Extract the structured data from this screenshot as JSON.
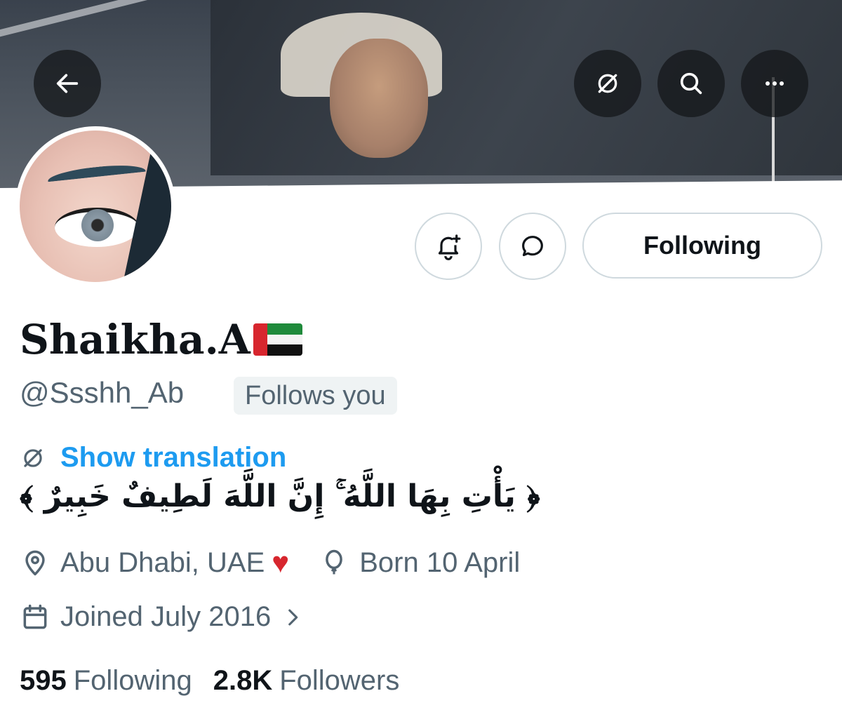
{
  "header": {
    "back_icon": "arrow-left-icon",
    "translate_icon": "translate-icon",
    "search_icon": "search-icon",
    "more_icon": "more-dots-icon"
  },
  "actions": {
    "notify_icon": "bell-plus-icon",
    "message_icon": "message-bubble-icon",
    "follow_label": "Following"
  },
  "profile": {
    "display_name": "Shaikha.A",
    "flag": "UAE flag",
    "handle": "@Ssshh_Ab",
    "follows_you": "Follows you",
    "show_translation": "Show translation",
    "bio": "﴿ يَأْتِ بِهَا اللَّهُ ۚ إِنَّ اللَّهَ لَطِيفٌ خَبِيرٌ ﴾",
    "location": "Abu Dhabi, UAE",
    "location_emoji": "♥",
    "birthday": "Born 10 April",
    "joined": "Joined July 2016"
  },
  "stats": {
    "following_count": "595",
    "following_label": "Following",
    "followers_count": "2.8K",
    "followers_label": "Followers"
  },
  "colors": {
    "accent": "#1d9bf0",
    "muted_text": "#536471",
    "primary_text": "#0f1419",
    "border": "#cfd9de"
  }
}
